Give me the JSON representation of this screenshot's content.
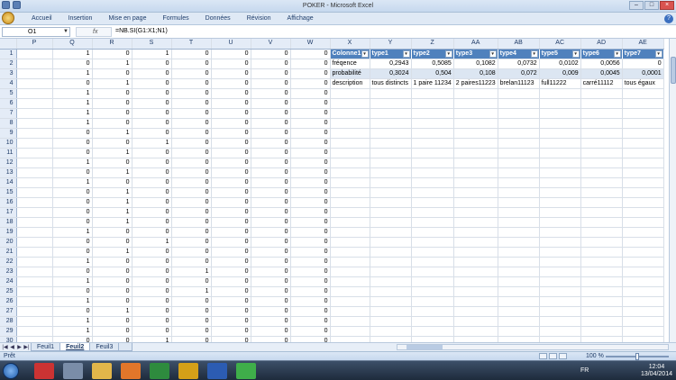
{
  "window": {
    "title": "POKER - Microsoft Excel"
  },
  "ribbon": {
    "tabs": [
      "Accueil",
      "Insertion",
      "Mise en page",
      "Formules",
      "Données",
      "Révision",
      "Affichage"
    ]
  },
  "formula_bar": {
    "cell_ref": "O1",
    "fx_label": "fx",
    "formula": "=NB.SI(G1:X1;N1)"
  },
  "columns": [
    "P",
    "Q",
    "R",
    "S",
    "T",
    "U",
    "V",
    "W",
    "X",
    "Y",
    "Z",
    "AA",
    "AB",
    "AC",
    "AD",
    "AE"
  ],
  "rows": [
    {
      "n": "1",
      "v": [
        "",
        "1",
        "0",
        "1",
        "0",
        "0",
        "0",
        "0"
      ]
    },
    {
      "n": "2",
      "v": [
        "",
        "0",
        "1",
        "0",
        "0",
        "0",
        "0",
        "0"
      ]
    },
    {
      "n": "3",
      "v": [
        "",
        "1",
        "0",
        "0",
        "0",
        "0",
        "0",
        "0"
      ]
    },
    {
      "n": "4",
      "v": [
        "",
        "0",
        "1",
        "0",
        "0",
        "0",
        "0",
        "0"
      ]
    },
    {
      "n": "5",
      "v": [
        "",
        "1",
        "0",
        "0",
        "0",
        "0",
        "0",
        "0"
      ]
    },
    {
      "n": "6",
      "v": [
        "",
        "1",
        "0",
        "0",
        "0",
        "0",
        "0",
        "0"
      ]
    },
    {
      "n": "7",
      "v": [
        "",
        "1",
        "0",
        "0",
        "0",
        "0",
        "0",
        "0"
      ]
    },
    {
      "n": "8",
      "v": [
        "",
        "1",
        "0",
        "0",
        "0",
        "0",
        "0",
        "0"
      ]
    },
    {
      "n": "9",
      "v": [
        "",
        "0",
        "1",
        "0",
        "0",
        "0",
        "0",
        "0"
      ]
    },
    {
      "n": "10",
      "v": [
        "",
        "0",
        "0",
        "1",
        "0",
        "0",
        "0",
        "0"
      ]
    },
    {
      "n": "11",
      "v": [
        "",
        "0",
        "1",
        "0",
        "0",
        "0",
        "0",
        "0"
      ]
    },
    {
      "n": "12",
      "v": [
        "",
        "1",
        "0",
        "0",
        "0",
        "0",
        "0",
        "0"
      ]
    },
    {
      "n": "13",
      "v": [
        "",
        "0",
        "1",
        "0",
        "0",
        "0",
        "0",
        "0"
      ]
    },
    {
      "n": "14",
      "v": [
        "",
        "1",
        "0",
        "0",
        "0",
        "0",
        "0",
        "0"
      ]
    },
    {
      "n": "15",
      "v": [
        "",
        "0",
        "1",
        "0",
        "0",
        "0",
        "0",
        "0"
      ]
    },
    {
      "n": "16",
      "v": [
        "",
        "0",
        "1",
        "0",
        "0",
        "0",
        "0",
        "0"
      ]
    },
    {
      "n": "17",
      "v": [
        "",
        "0",
        "1",
        "0",
        "0",
        "0",
        "0",
        "0"
      ]
    },
    {
      "n": "18",
      "v": [
        "",
        "0",
        "1",
        "0",
        "0",
        "0",
        "0",
        "0"
      ]
    },
    {
      "n": "19",
      "v": [
        "",
        "1",
        "0",
        "0",
        "0",
        "0",
        "0",
        "0"
      ]
    },
    {
      "n": "20",
      "v": [
        "",
        "0",
        "0",
        "1",
        "0",
        "0",
        "0",
        "0"
      ]
    },
    {
      "n": "21",
      "v": [
        "",
        "0",
        "1",
        "0",
        "0",
        "0",
        "0",
        "0"
      ]
    },
    {
      "n": "22",
      "v": [
        "",
        "1",
        "0",
        "0",
        "0",
        "0",
        "0",
        "0"
      ]
    },
    {
      "n": "23",
      "v": [
        "",
        "0",
        "0",
        "0",
        "1",
        "0",
        "0",
        "0"
      ]
    },
    {
      "n": "24",
      "v": [
        "",
        "1",
        "0",
        "0",
        "0",
        "0",
        "0",
        "0"
      ]
    },
    {
      "n": "25",
      "v": [
        "",
        "0",
        "0",
        "0",
        "1",
        "0",
        "0",
        "0"
      ]
    },
    {
      "n": "26",
      "v": [
        "",
        "1",
        "0",
        "0",
        "0",
        "0",
        "0",
        "0"
      ]
    },
    {
      "n": "27",
      "v": [
        "",
        "0",
        "1",
        "0",
        "0",
        "0",
        "0",
        "0"
      ]
    },
    {
      "n": "28",
      "v": [
        "",
        "1",
        "0",
        "0",
        "0",
        "0",
        "0",
        "0"
      ]
    },
    {
      "n": "29",
      "v": [
        "",
        "1",
        "0",
        "0",
        "0",
        "0",
        "0",
        "0"
      ]
    },
    {
      "n": "30",
      "v": [
        "",
        "0",
        "0",
        "1",
        "0",
        "0",
        "0",
        "0"
      ]
    }
  ],
  "summary_table": {
    "headers": [
      "Colonne1",
      "type1",
      "type2",
      "type3",
      "type4",
      "type5",
      "type6",
      "type7"
    ],
    "rows": [
      [
        "fréqence",
        "0,2943",
        "0,5085",
        "0,1082",
        "0,0732",
        "0,0102",
        "0,0056",
        "0"
      ],
      [
        "probabilité",
        "0,3024",
        "0,504",
        "0,108",
        "0,072",
        "0,009",
        "0,0045",
        "0,0001"
      ],
      [
        "description",
        "tous distincts",
        "1 paire 11234",
        "2 paires11223",
        "brelan11123",
        "full11222",
        "carré11112",
        "tous égaux"
      ]
    ]
  },
  "sheets": {
    "tabs": [
      "Feuil1",
      "Feuil2",
      "Feuil3"
    ],
    "active": "Feuil2"
  },
  "status": {
    "text": "Prêt",
    "zoom": "100 %"
  },
  "taskbar": {
    "lang": "FR",
    "time": "12:04",
    "date": "13/04/2014"
  },
  "colors": {
    "table_header": "#4f81bd",
    "table_band": "#dce6f2"
  }
}
